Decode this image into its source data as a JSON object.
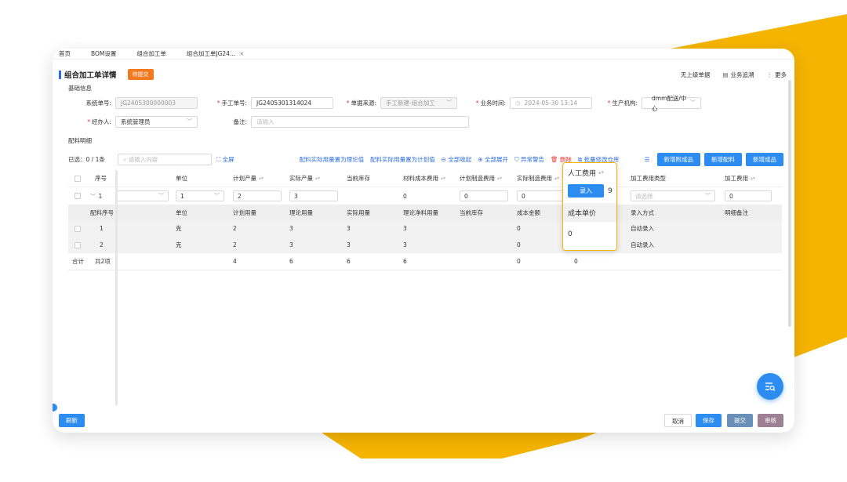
{
  "tabs": [
    {
      "label": "首页",
      "active": false
    },
    {
      "label": "BOM设置",
      "active": false
    },
    {
      "label": "组合加工单",
      "active": false
    },
    {
      "label": "组合加工单JG24...",
      "active": true,
      "closable": true
    }
  ],
  "header": {
    "title": "组合加工单详情",
    "status": "待提交",
    "actions": [
      {
        "label": "无上级单据",
        "icon": ""
      },
      {
        "label": "业务追溯",
        "icon": "trace-icon"
      },
      {
        "label": "更多",
        "icon": "more-vertical-icon"
      }
    ]
  },
  "basic": {
    "section_title": "基础信息",
    "system_no_label": "系统单号:",
    "system_no_value": "JG2405300000003",
    "manual_no_label": "手工单号:",
    "manual_no_value": "JG2405301314024",
    "source_label": "单据来源:",
    "source_value": "手工新建-组合加工",
    "biz_time_label": "业务时间:",
    "biz_time_value": "2024-05-30 13:14",
    "org_label": "生产机构:",
    "org_value": "dmm配送/中心",
    "handler_label": "经办人:",
    "handler_value": "系统管理员",
    "remark_label": "备注:",
    "remark_placeholder": "请输入"
  },
  "detail": {
    "section_title": "配料明细",
    "selected_text": "已选：0 / 1条",
    "search_placeholder": "请输入内容",
    "fullscreen_label": "全屏",
    "links": [
      {
        "label": "配料实际用量置为理论值",
        "icon": "",
        "color": "blue"
      },
      {
        "label": "配料实际用量置为计划值",
        "icon": "",
        "color": "blue"
      },
      {
        "label": "全部收起",
        "icon": "collapse-icon",
        "color": "blue"
      },
      {
        "label": "全部展开",
        "icon": "expand-icon",
        "color": "blue"
      },
      {
        "label": "异常警告",
        "icon": "shield-icon",
        "color": "blue"
      },
      {
        "label": "删除",
        "icon": "trash-icon",
        "color": "red"
      },
      {
        "label": "批量修改仓库",
        "icon": "batch-edit-icon",
        "color": "blue"
      }
    ],
    "buttons": [
      "新增附成品",
      "新增配料",
      "新增成品"
    ]
  },
  "table": {
    "headers": [
      "序号",
      "单位",
      "计划产量",
      "实际产量",
      "当前库存",
      "材料成本费用",
      "计划制造费用",
      "实际制造费用",
      "人工费用",
      "加工费用类型",
      "加工费用"
    ],
    "main_row": {
      "index": "1",
      "unit": "1",
      "plan_qty": "2",
      "actual_qty": "3",
      "material_cost": "0",
      "plan_mfg_cost": "0",
      "actual_mfg_cost": "0",
      "processing_type_placeholder": "请选择",
      "processing_fee": "0"
    },
    "sub_headers": [
      "配料序号",
      "单位",
      "计划用量",
      "理论用量",
      "实际用量",
      "理论净料用量",
      "当前库存",
      "成本金额",
      "成本单价",
      "录入方式",
      "明细备注"
    ],
    "sub_rows": [
      {
        "index": "1",
        "unit": "克",
        "plan": "2",
        "theory": "3",
        "actual": "3",
        "net": "3",
        "cost": "0",
        "entry": "自动录入"
      },
      {
        "index": "2",
        "unit": "克",
        "plan": "2",
        "theory": "3",
        "actual": "3",
        "net": "3",
        "cost": "0",
        "entry": "自动录入"
      }
    ],
    "total": {
      "label": "合计",
      "count": "共2项",
      "plan": "4",
      "theory": "6",
      "actual": "6",
      "net": "6",
      "cost": "0",
      "unit_price": "0"
    }
  },
  "popup": {
    "header": "人工费用",
    "button": "录入",
    "value": "9",
    "sub_header": "成本单价",
    "sub_value": "0"
  },
  "footer": {
    "refresh": "刷新",
    "cancel": "取消",
    "save": "保存",
    "submit": "提交",
    "audit": "审核"
  },
  "colors": {
    "accent_blue": "#2d8cf0",
    "status_orange": "#f47a20",
    "background_yellow": "#f5b400",
    "popup_border": "#f5b400"
  }
}
